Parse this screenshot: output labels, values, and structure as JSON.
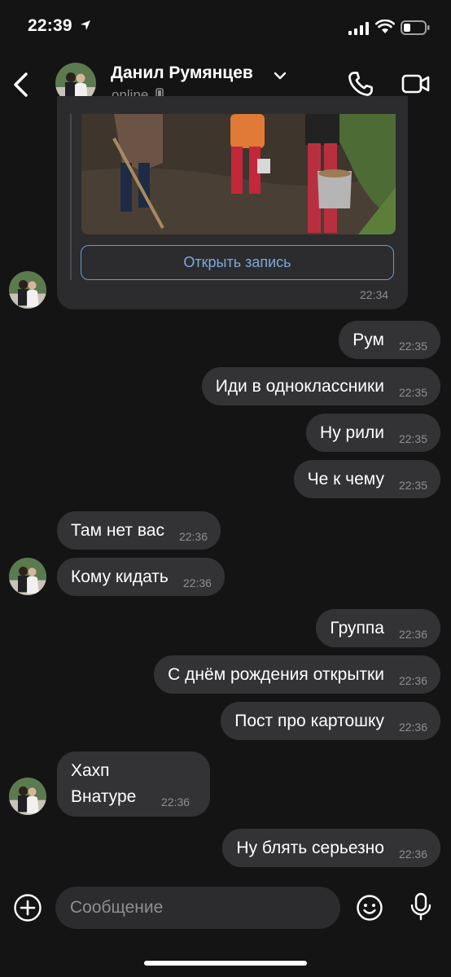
{
  "status_bar": {
    "time": "22:39"
  },
  "header": {
    "name": "Данил Румянцев",
    "status": "online"
  },
  "post": {
    "button_label": "Открыть запись",
    "time": "22:34"
  },
  "messages": [
    {
      "text": "Рум",
      "time": "22:35"
    },
    {
      "text": "Иди в одноклассники",
      "time": "22:35"
    },
    {
      "text": "Ну рили",
      "time": "22:35"
    },
    {
      "text": "Че к чему",
      "time": "22:35"
    },
    {
      "text": "Там нет вас",
      "time": "22:36"
    },
    {
      "text": "Кому кидать",
      "time": "22:36"
    },
    {
      "text": "Группа",
      "time": "22:36"
    },
    {
      "text": "С днём рождения открытки",
      "time": "22:36"
    },
    {
      "text": "Пост про картошку",
      "time": "22:36"
    },
    {
      "line1": "Хахп",
      "line2": "Внатуре",
      "time": "22:36"
    },
    {
      "text": "Ну блять серьезно",
      "time": "22:36"
    }
  ],
  "composer": {
    "placeholder": "Сообщение"
  },
  "colors": {
    "background": "#141414",
    "bubble": "#333335",
    "accent": "#7fa7dc"
  }
}
